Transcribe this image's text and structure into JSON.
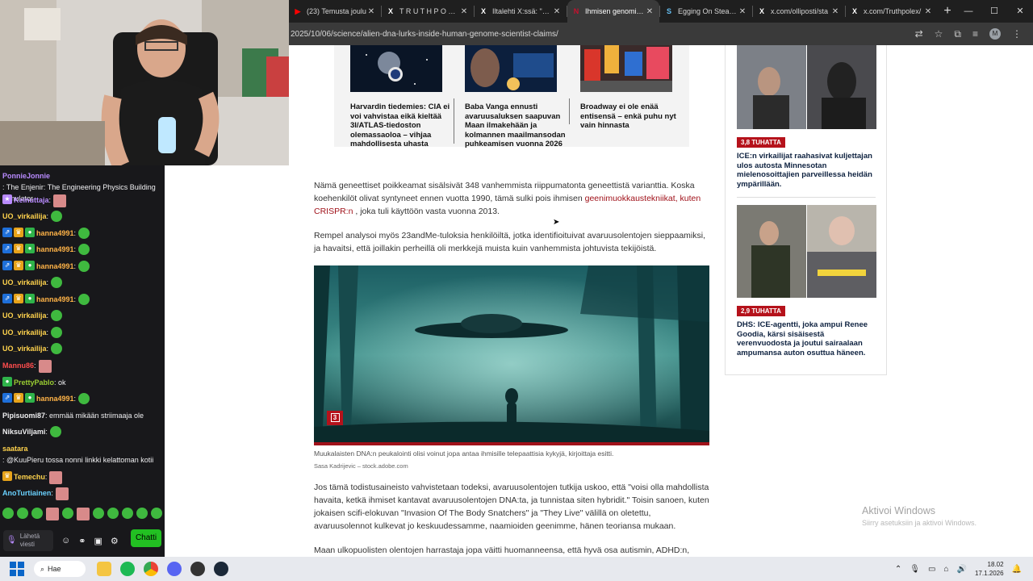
{
  "browser": {
    "tabs": [
      {
        "label": "(23) Temusta joulu",
        "icon": "youtube-icon",
        "active": false
      },
      {
        "label": "T R U T H P O L E X",
        "icon": "x-icon",
        "active": false
      },
      {
        "label": "Iltalehti X:ssä: \"Lah",
        "icon": "x-icon",
        "active": false
      },
      {
        "label": "Ihmisen genomissa",
        "icon": "news-icon",
        "active": true
      },
      {
        "label": "Egging On Steamin",
        "icon": "steam-icon",
        "active": false
      },
      {
        "label": "x.com/olliposti/sta",
        "icon": "x-icon",
        "active": false
      },
      {
        "label": "x.com/Truthpolex/",
        "icon": "x-icon",
        "active": false
      }
    ],
    "url": "2025/10/06/science/alien-dna-lurks-inside-human-genome-scientist-claims/",
    "profile_initial": "M"
  },
  "related": [
    {
      "caption": "Harvardin tiedemies: CIA ei voi vahvistaa eikä kieltää 3I/ATLAS-tiedoston olemassaoloa – vihjaa mahdollisesta uhasta"
    },
    {
      "caption": "Baba Vanga ennusti avaruusaluksen saapuvan Maan ilmakehään ja kolmannen maailmansodan puhkeamisen vuonna 2026"
    },
    {
      "caption": "Broadway ei ole enää entisensä – enkä puhu nyt vain hinnasta"
    }
  ],
  "article": {
    "p1_a": "Nämä geneettiset poikkeamat sisälsivät 348 vanhemmista riippumatonta geneettistä varianttia. Koska koehenkilöt olivat syntyneet ennen vuotta 1990, tämä sulki pois ihmisen ",
    "p1_link": "geenimuokkaustekniikat, kuten CRISPR:n",
    "p1_b": " , joka tuli käyttöön vasta vuonna 2013.",
    "p2": "Rempel analysoi myös 23andMe-tuloksia henkilöiltä, jotka identifioituivat avaruusolentojen sieppaamiksi, ja havaitsi, että joillakin perheillä oli merkkejä muista kuin vanhemmista johtuvista tekijöistä.",
    "image_count": "3",
    "caption": "Muukalaisten DNA:n peukalointi olisi voinut jopa antaa ihmisille telepaattisia kykyjä, kirjoittaja esitti.",
    "credit": "Sasa Kadrijevic – stock.adobe.com",
    "p3": "Jos tämä todistusaineisto vahvistetaan todeksi, avaruusolentojen tutkija uskoo, että \"voisi olla mahdollista havaita, ketkä ihmiset kantavat avaruusolentojen DNA:ta, ja tunnistaa siten hybridit.\" Toisin sanoen, kuten jokaisen scifi-elokuvan \"Invasion Of The Body Snatchers\" ja \"They Live\" välillä on oletettu, avaruusolennot kulkevat jo keskuudessamme, naamioiden geenimme, hänen teoriansa mukaan.",
    "p4": "Maan ulkopuolisten olentojen harrastaja jopa väitti huomanneensa, että hyvä osa autismin, ADHD:n,"
  },
  "sidebar": [
    {
      "badge": "3,8 TUHATTA",
      "title": "ICE:n virkailijat raahasivat kuljettajan ulos autosta Minnesotan mielenosoittajien parveillessa heidän ympärillään."
    },
    {
      "badge": "2,9 TUHATTA",
      "title": "DHS: ICE-agentti, joka ampui Renee Goodia, kärsi sisäisestä verenvuodosta ja joutui sairaalaan ampumansa auton osuttua häneen."
    }
  ],
  "watermark": {
    "line1": "Aktivoi Windows",
    "line2": "Siirry asetuksiin ja aktivoi Windows."
  },
  "chat": [
    {
      "user": "PonnieJonnie",
      "color": "#b98bff",
      "text": ": The Enjenir: The Engineering Physics Building Simulator",
      "badges": []
    },
    {
      "user": "Keinuttaja",
      "color": "#b98bff",
      "text": ":",
      "badges": [
        "sub"
      ],
      "emote": "face"
    },
    {
      "user": "UO_virkailija",
      "color": "#ffd34d",
      "text": ":",
      "badges": [],
      "emote": "pepe"
    },
    {
      "user": "hanna4991",
      "color": "#ffb347",
      "text": ":",
      "badges": [
        "prime",
        "crown",
        "drop"
      ],
      "emote": "pepe"
    },
    {
      "user": "hanna4991",
      "color": "#ffb347",
      "text": ":",
      "badges": [
        "prime",
        "crown",
        "drop"
      ],
      "emote": "pepe"
    },
    {
      "user": "hanna4991",
      "color": "#ffb347",
      "text": ":",
      "badges": [
        "prime",
        "crown",
        "drop"
      ],
      "emote": "pepe"
    },
    {
      "user": "UO_virkailija",
      "color": "#ffd34d",
      "text": ":",
      "badges": [],
      "emote": "pepe"
    },
    {
      "user": "hanna4991",
      "color": "#ffb347",
      "text": ":",
      "badges": [
        "prime",
        "crown",
        "drop"
      ],
      "emote": "pepe"
    },
    {
      "user": "UO_virkailija",
      "color": "#ffd34d",
      "text": ":",
      "badges": [],
      "emote": "pepe"
    },
    {
      "user": "UO_virkailija",
      "color": "#ffd34d",
      "text": ":",
      "badges": [],
      "emote": "pepe"
    },
    {
      "user": "UO_virkailija",
      "color": "#ffd34d",
      "text": ":",
      "badges": [],
      "emote": "pepe"
    },
    {
      "user": "Mannu86",
      "color": "#ff4d4d",
      "text": ":",
      "badges": [],
      "emote": "face"
    },
    {
      "user": "PrettyPablo",
      "color": "#9acd32",
      "text": ": ok",
      "badges": [
        "drop"
      ]
    },
    {
      "user": "hanna4991",
      "color": "#ffb347",
      "text": ":",
      "badges": [
        "prime",
        "crown",
        "drop"
      ],
      "emote": "pepe"
    },
    {
      "user": "Pipisuomi87",
      "color": "#efeff1",
      "text": ": emmää mikään striimaaja ole",
      "badges": []
    },
    {
      "user": "NiksuViljami",
      "color": "#efeff1",
      "text": ":",
      "badges": [],
      "emote": "pepe"
    },
    {
      "user": "saatara",
      "color": "#ffd34d",
      "text": ": @KuuPieru tossa nonni linkki kelattoman kotii",
      "badges": []
    },
    {
      "user": "Temechu",
      "color": "#ffd34d",
      "text": ":",
      "badges": [
        "crown"
      ],
      "emote": "face"
    },
    {
      "user": "AnoTurtiainen",
      "color": "#6ad1ff",
      "text": ":",
      "badges": [],
      "emote": "face"
    }
  ],
  "chat_input": {
    "placeholder": "Lähetä viesti",
    "send_label": "Chatti"
  },
  "taskbar": {
    "search_label": "Hae",
    "time": "18.02",
    "date": "17.1.2026"
  }
}
